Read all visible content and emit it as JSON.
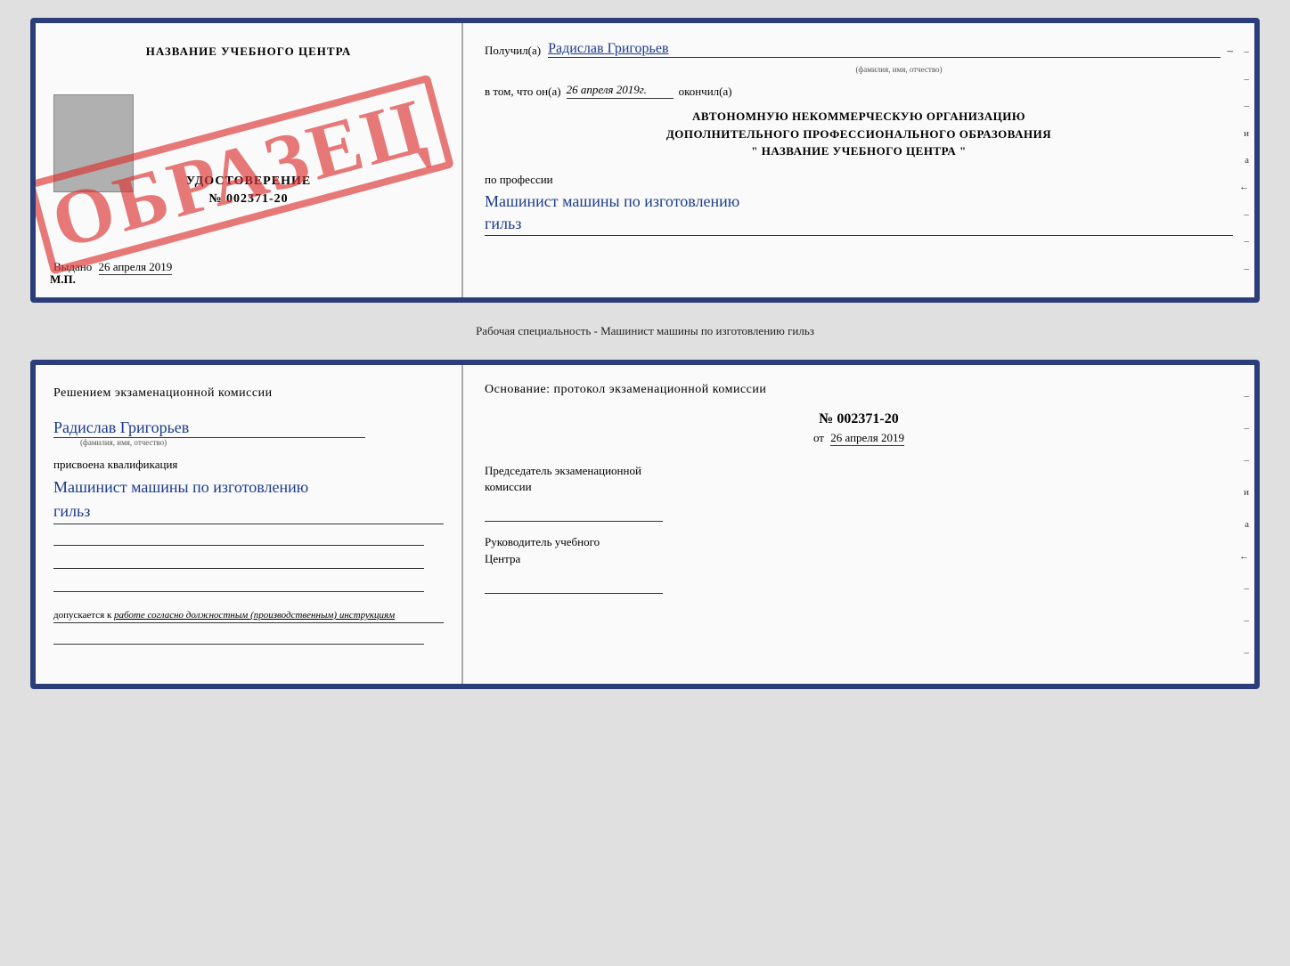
{
  "top_doc": {
    "left": {
      "center_title": "НАЗВАНИЕ УЧЕБНОГО ЦЕНТРА",
      "photo_placeholder": true,
      "certificate_label": "УДОСТОВЕРЕНИЕ",
      "certificate_number": "№ 002371-20",
      "issued_prefix": "Выдано",
      "issued_date": "26 апреля 2019",
      "mp_label": "М.П.",
      "stamp_text": "ОБРАЗЕЦ"
    },
    "right": {
      "received_label": "Получил(а)",
      "recipient_name": "Радислав Григорьев",
      "recipient_dash": "–",
      "fio_sub": "(фамилия, имя, отчество)",
      "completed_prefix": "в том, что он(а)",
      "completed_date": "26 апреля 2019г.",
      "completed_suffix": "окончил(а)",
      "org_title_line1": "АВТОНОМНУЮ НЕКОММЕРЧЕСКУЮ ОРГАНИЗАЦИЮ",
      "org_title_line2": "ДОПОЛНИТЕЛЬНОГО ПРОФЕССИОНАЛЬНОГО ОБРАЗОВАНИЯ",
      "org_title_line3": "\"  НАЗВАНИЕ УЧЕБНОГО ЦЕНТРА  \"",
      "profession_prefix": "по профессии",
      "profession_name_line1": "Машинист машины по изготовлению",
      "profession_name_line2": "гильз",
      "margin_marks": [
        "–",
        "–",
        "–",
        "и",
        "а",
        "←",
        "–",
        "–",
        "–"
      ]
    }
  },
  "separator": {
    "text": "Рабочая специальность - Машинист машины по изготовлению гильз"
  },
  "bottom_doc": {
    "left": {
      "decision_title": "Решением  экзаменационной  комиссии",
      "person_name": "Радислав Григорьев",
      "fio_sub": "(фамилия, имя, отчество)",
      "assigned_label": "присвоена квалификация",
      "qualification_line1": "Машинист  машины  по  изготовлению",
      "qualification_line2": "гильз",
      "allowed_prefix": "допускается к",
      "allowed_text": "работе согласно должностным (производственным) инструкциям"
    },
    "right": {
      "basis_title": "Основание:  протокол  экзаменационной  комиссии",
      "protocol_number": "№  002371-20",
      "protocol_date_prefix": "от",
      "protocol_date": "26 апреля 2019",
      "chair_label_line1": "Председатель экзаменационной",
      "chair_label_line2": "комиссии",
      "center_leader_line1": "Руководитель учебного",
      "center_leader_line2": "Центра",
      "margin_marks": [
        "–",
        "–",
        "–",
        "и",
        "а",
        "←",
        "–",
        "–",
        "–"
      ]
    }
  }
}
